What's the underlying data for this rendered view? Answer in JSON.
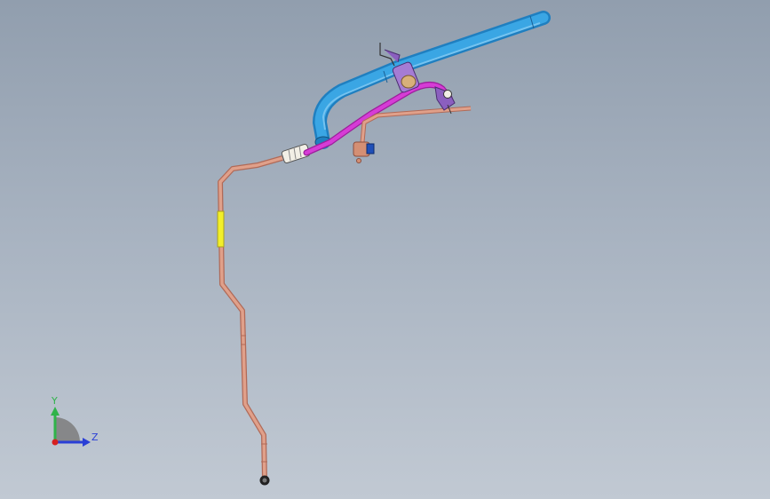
{
  "viewport": {
    "background_top": "#919eae",
    "background_bottom": "#c1c9d3"
  },
  "colors": {
    "blue_hose": "#3aa6e4",
    "blue_hose_dark": "#1f7fc0",
    "magenta_hose": "#d63cd6",
    "copper_pipe": "#e0a08a",
    "copper_pipe_edge": "#b06a58",
    "yellow_band": "#f2ef2a",
    "bracket_purple": "#8b5fbf",
    "fitting_tan": "#d8b07a"
  },
  "triad": {
    "y_label": "Y",
    "z_label": "Z",
    "y_color": "#2fb34a",
    "z_color": "#2a3fd6",
    "x_color": "#d62020",
    "icons": [
      "axis-triad-icon"
    ]
  }
}
